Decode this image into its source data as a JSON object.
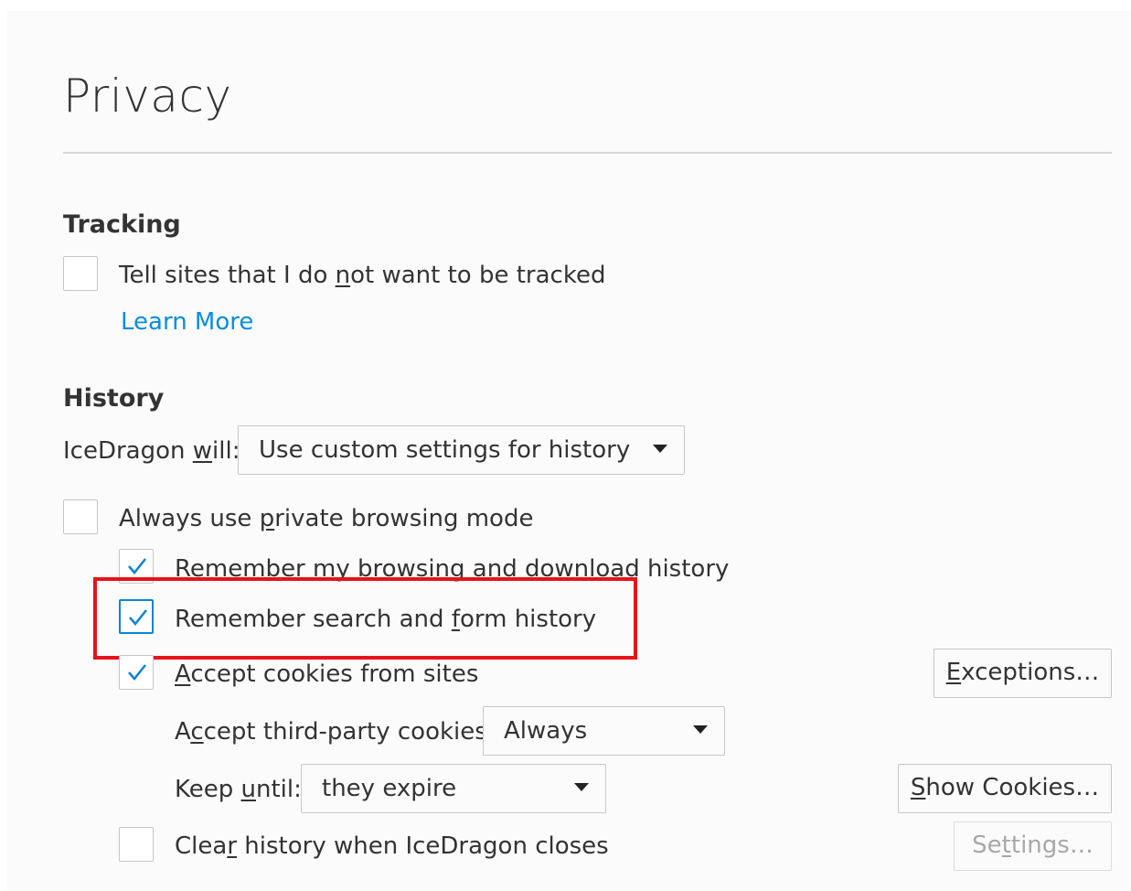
{
  "page": {
    "title": "Privacy"
  },
  "tracking": {
    "heading": "Tracking",
    "dnt_label_pre": "Tell sites that I do ",
    "dnt_label_key": "n",
    "dnt_label_post": "ot want to be tracked",
    "dnt_checked": false,
    "learn_more": "Learn More"
  },
  "history": {
    "heading": "History",
    "will_label_pre": "IceDragon ",
    "will_label_key": "w",
    "will_label_post": "ill:",
    "mode_value": "Use custom settings for history",
    "private_pre": "Always use ",
    "private_key": "p",
    "private_post": "rivate browsing mode",
    "private_checked": false,
    "browsing_pre": "Remem",
    "browsing_key": "b",
    "browsing_post": "er my browsing and download history",
    "browsing_checked": true,
    "search_pre": "Remember search and ",
    "search_key": "f",
    "search_post": "orm history",
    "search_checked": true,
    "cookies_key": "A",
    "cookies_post": "ccept cookies from sites",
    "cookies_checked": true,
    "exceptions_key": "E",
    "exceptions_post": "xceptions…",
    "third_party_pre": "A",
    "third_party_key": "c",
    "third_party_post": "cept third-party cookies:",
    "third_party_value": "Always",
    "keep_pre": "Keep ",
    "keep_key": "u",
    "keep_post": "ntil:",
    "keep_value": "they expire",
    "show_cookies_key": "S",
    "show_cookies_post": "how Cookies…",
    "clear_pre": "Clea",
    "clear_key": "r",
    "clear_post": " history when IceDragon closes",
    "clear_checked": false,
    "settings_pre": "Se",
    "settings_key": "t",
    "settings_post": "tings…"
  },
  "colors": {
    "accent": "#0a84d6",
    "highlight": "#e8121a",
    "link": "#0a8dde"
  },
  "icons": {
    "check": "checkmark-icon",
    "dropdown": "chevron-down-icon"
  }
}
